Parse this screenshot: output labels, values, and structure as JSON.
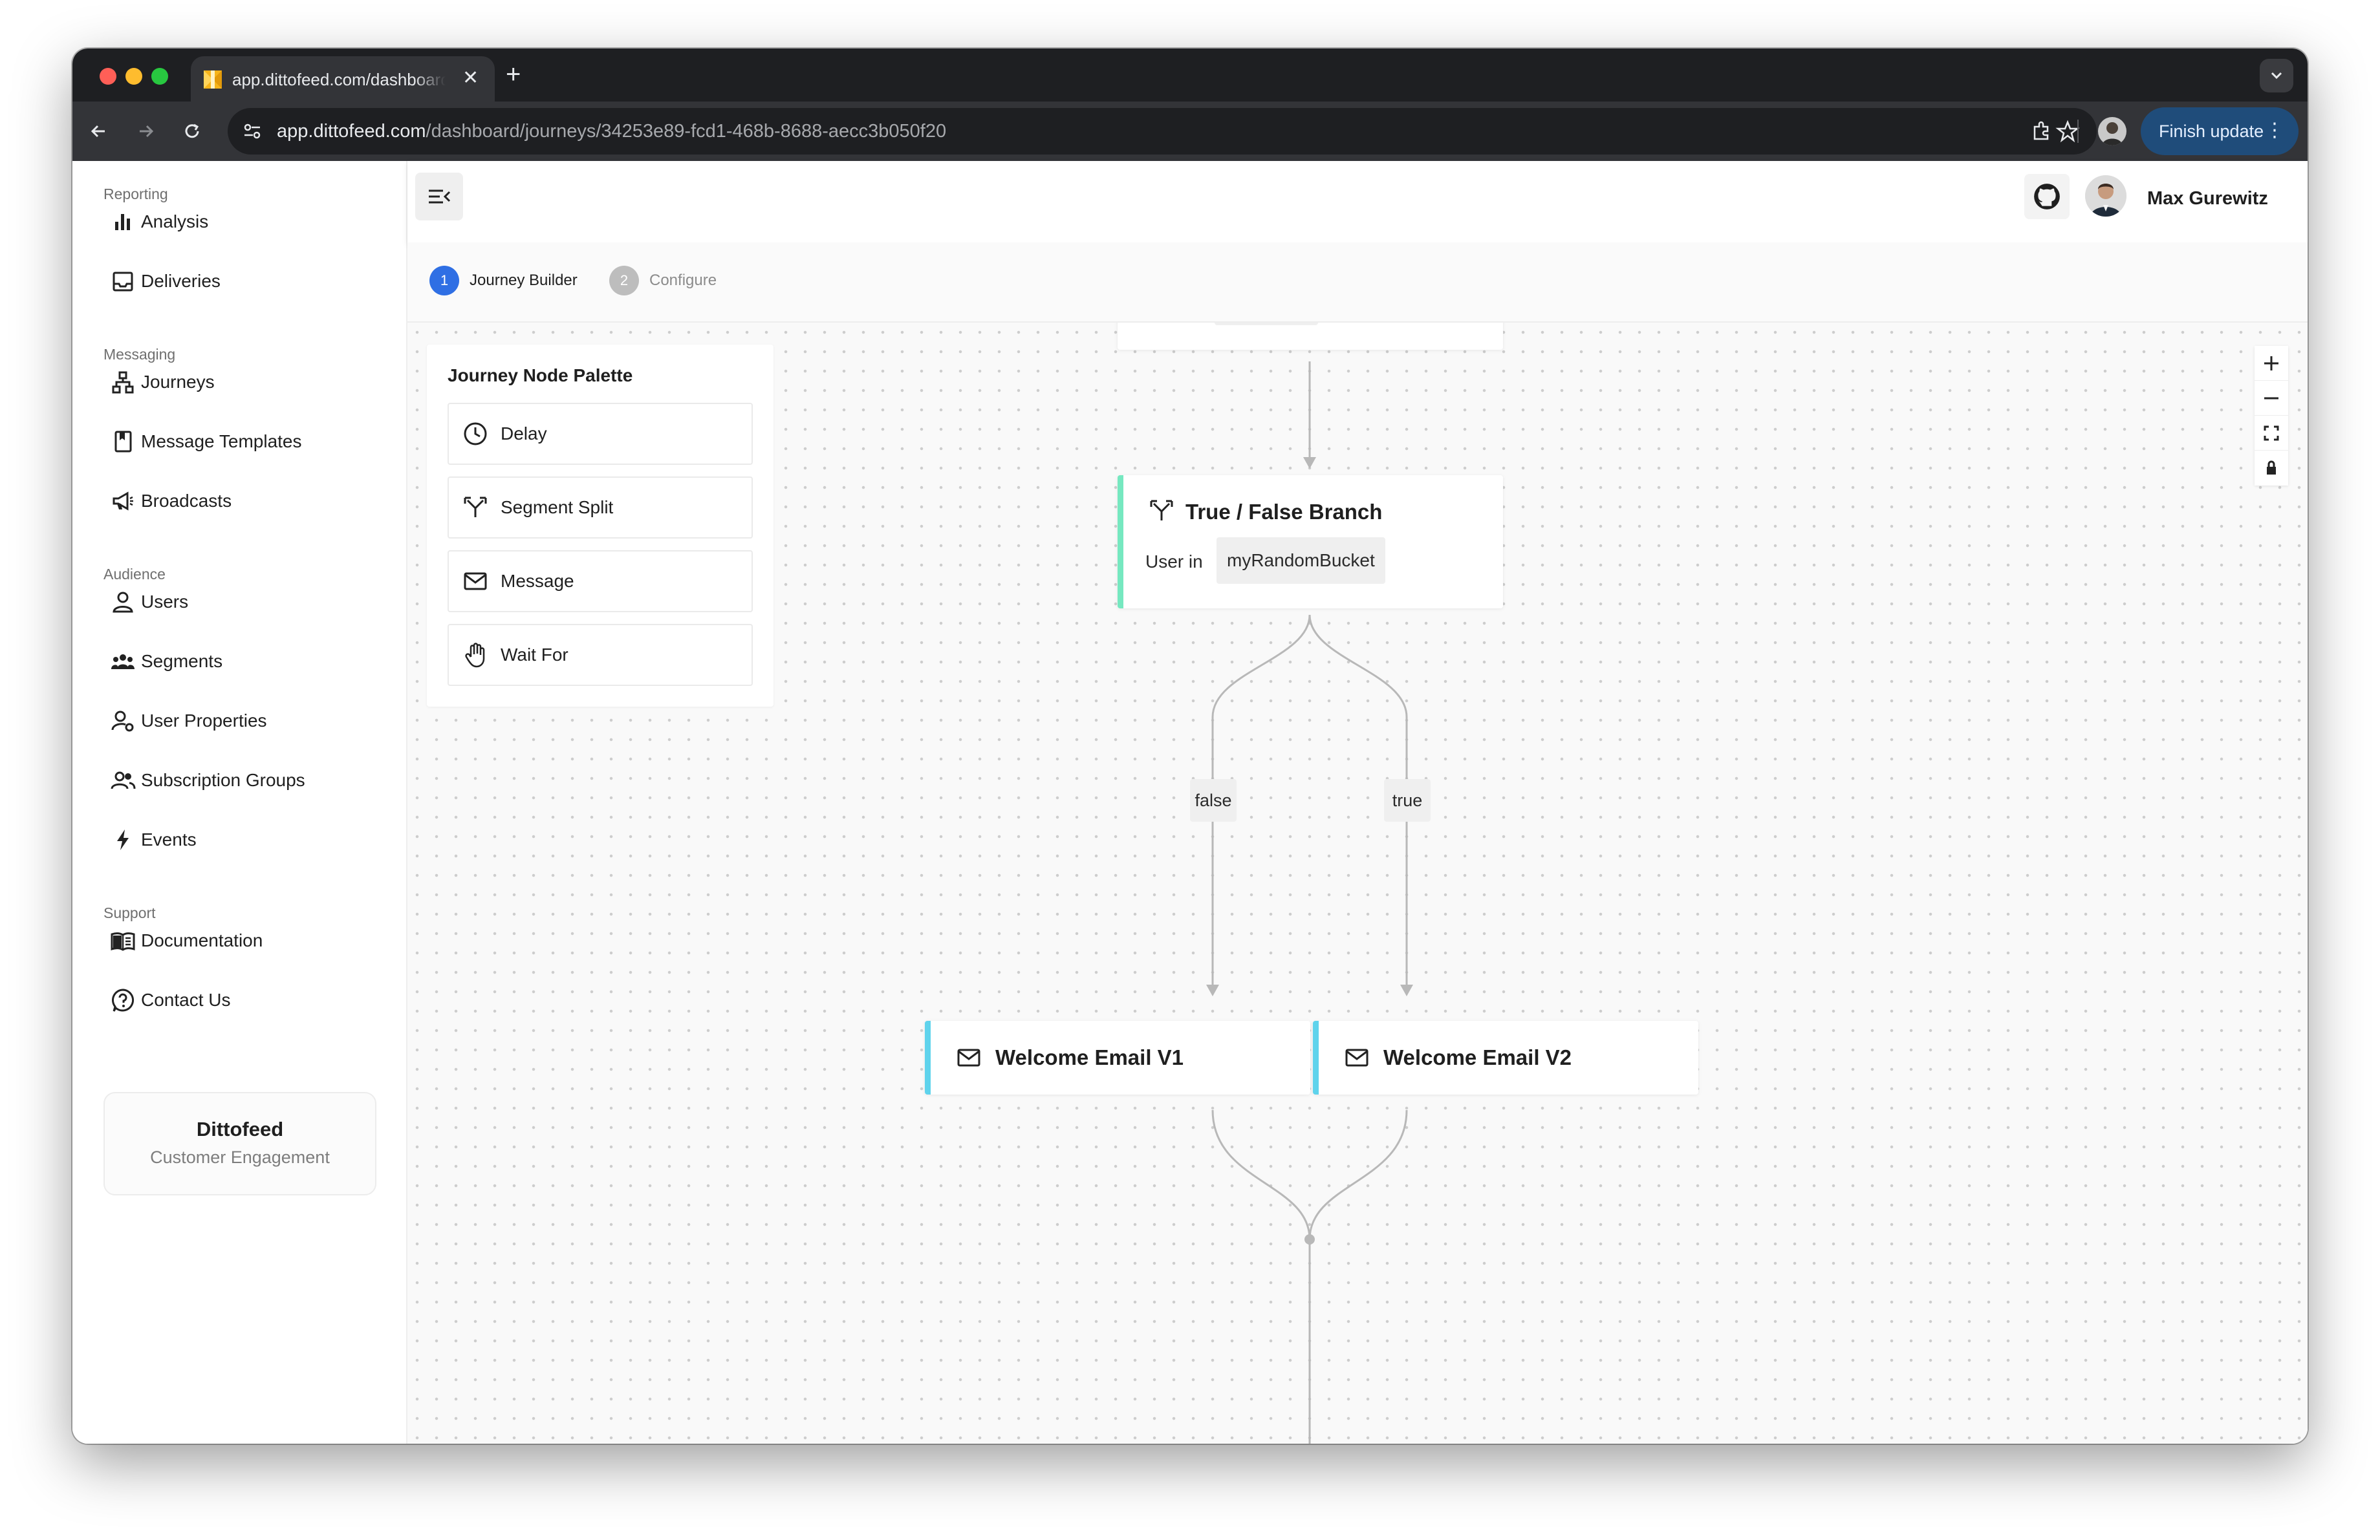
{
  "browser": {
    "tab_title": "app.dittofeed.com/dashboard/journeys",
    "url_host": "app.dittofeed.com",
    "url_path": "/dashboard/journeys/34253e89-fcd1-468b-8688-aecc3b050f20",
    "update_button": "Finish update"
  },
  "sidebar": {
    "sections": [
      {
        "label": "Reporting",
        "items": [
          {
            "label": "Analysis",
            "icon": "bar-chart-icon"
          },
          {
            "label": "Deliveries",
            "icon": "inbox-icon"
          }
        ]
      },
      {
        "label": "Messaging",
        "items": [
          {
            "label": "Journeys",
            "icon": "sitemap-icon"
          },
          {
            "label": "Message Templates",
            "icon": "book-icon"
          },
          {
            "label": "Broadcasts",
            "icon": "megaphone-icon"
          }
        ]
      },
      {
        "label": "Audience",
        "items": [
          {
            "label": "Users",
            "icon": "user-icon"
          },
          {
            "label": "Segments",
            "icon": "group-icon"
          },
          {
            "label": "User Properties",
            "icon": "user-settings-icon"
          },
          {
            "label": "Subscription Groups",
            "icon": "users-icon"
          },
          {
            "label": "Events",
            "icon": "lightning-icon"
          }
        ]
      },
      {
        "label": "Support",
        "items": [
          {
            "label": "Documentation",
            "icon": "docs-icon"
          },
          {
            "label": "Contact Us",
            "icon": "help-icon"
          }
        ]
      }
    ],
    "brand_name": "Dittofeed",
    "brand_sub": "Customer Engagement"
  },
  "header": {
    "user_name": "Max Gurewitz"
  },
  "stepper": {
    "steps": [
      {
        "num": "1",
        "label": "Journey Builder",
        "active": true
      },
      {
        "num": "2",
        "label": "Configure",
        "active": false
      }
    ]
  },
  "palette": {
    "title": "Journey Node Palette",
    "items": [
      {
        "label": "Delay",
        "icon": "clock-icon"
      },
      {
        "label": "Segment Split",
        "icon": "split-icon"
      },
      {
        "label": "Message",
        "icon": "mail-icon"
      },
      {
        "label": "Wait For",
        "icon": "hand-icon"
      }
    ]
  },
  "flow": {
    "branch_node": {
      "title": "True / False Branch",
      "prefix": "User in",
      "segment": "myRandomBucket"
    },
    "edge_false": "false",
    "edge_true": "true",
    "message_v1": "Welcome Email V1",
    "message_v2": "Welcome Email V2"
  },
  "colors": {
    "branch_accent": "#76e8c0",
    "message_accent": "#5fd3ec",
    "step_active": "#2f6fe4",
    "step_inactive": "#bdbdbd"
  }
}
